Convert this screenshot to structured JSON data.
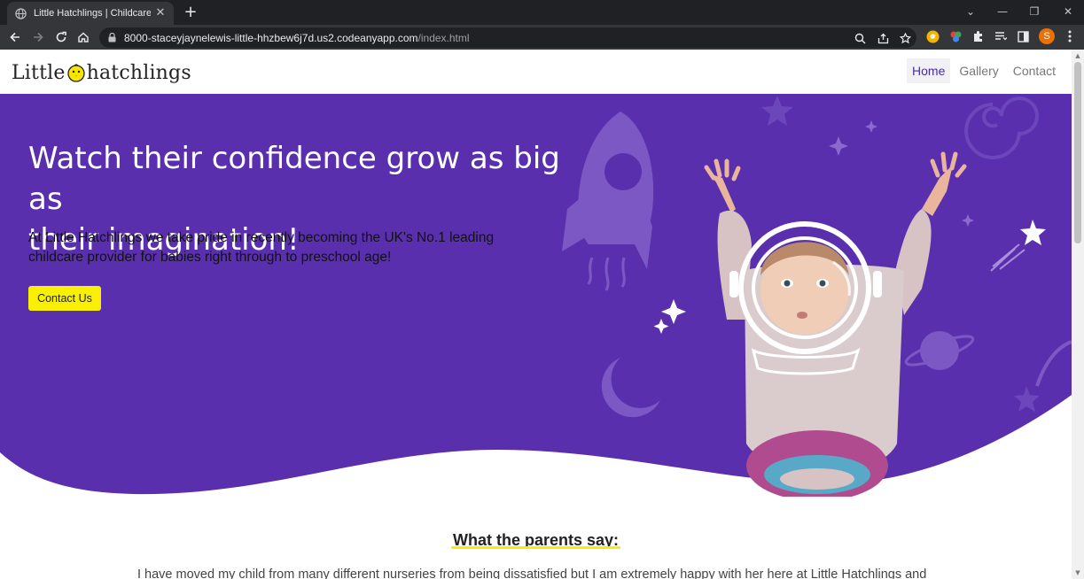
{
  "browser": {
    "tab_title": "Little Hatchlings | Childcare Nurs",
    "url_host": "8000-staceyjaynelewis-little-hhzbew6j7d.us2.codeanyapp.com",
    "url_path": "/index.html",
    "profile_initial": "S"
  },
  "site": {
    "logo_text_left": "Little",
    "logo_text_right": "hatchlings",
    "nav": [
      {
        "label": "Home",
        "active": true
      },
      {
        "label": "Gallery",
        "active": false
      },
      {
        "label": "Contact",
        "active": false
      }
    ]
  },
  "hero": {
    "title_part1": "Watch their ",
    "title_hl1": "confidence",
    "title_part2": " grow as ",
    "title_hl2": "big",
    "title_part3": " as",
    "title_line2": "their imagination!",
    "text": "At Little Hatchlings we take pride in recently becoming the UK's No.1 leading childcare provider for babies right through to preschool age!",
    "button_label": "Contact Us"
  },
  "testimonials": {
    "heading": "What the parents say:",
    "first_line": "I have moved my child from many different nurseries from being dissatisfied but I am extremely happy with her here at Little Hatchlings and"
  },
  "colors": {
    "hero_purple": "#5a2fae",
    "accent_yellow": "#f8f000",
    "nav_active": "#4b2aa6"
  }
}
